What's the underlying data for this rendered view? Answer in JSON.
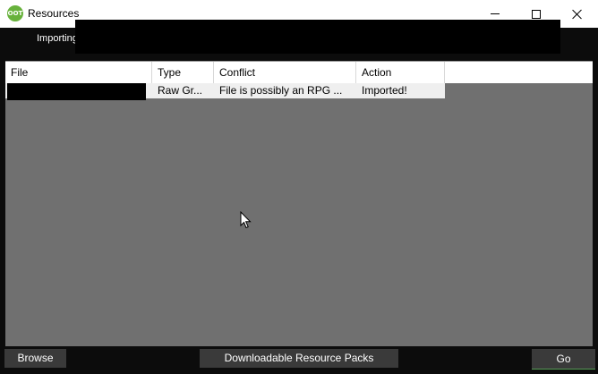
{
  "window": {
    "title": "Resources",
    "icon_text": "OOT"
  },
  "status": {
    "label": "Importing"
  },
  "table": {
    "columns": [
      "File",
      "Type",
      "Conflict",
      "Action"
    ],
    "rows": [
      {
        "file": "",
        "type": "Raw Gr...",
        "conflict": "File is possibly an RPG ...",
        "action": "Imported!"
      }
    ]
  },
  "buttons": {
    "browse": "Browse",
    "packs": "Downloadable Resource Packs",
    "go": "Go"
  },
  "colors": {
    "background": "#0c0c0c",
    "table_bg": "#707070",
    "button_bg": "#3a3a3a",
    "icon_green": "#68b23c"
  }
}
